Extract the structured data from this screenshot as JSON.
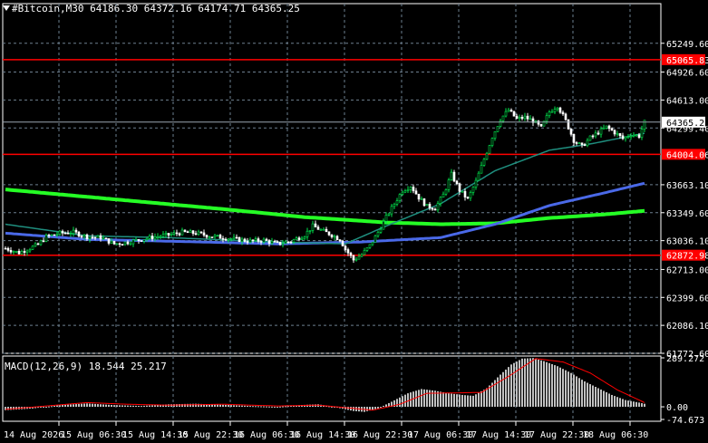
{
  "header": {
    "symbol": "#Bitcoin,M30",
    "ohlc": "64186.30 64372.16 64174.71 64365.25"
  },
  "macd_header": {
    "label": "MACD(12,26,9) 18.544 25.217"
  },
  "colors": {
    "background": "#000000",
    "grid": "#6d7f8f",
    "bull_candle": "#00e64d",
    "bear_candle": "#ffffff",
    "ma_fast": "#1f8f7f",
    "ma_mid": "#4a69e8",
    "ma_slow": "#25ff25",
    "level_line": "#ff0000",
    "macd_hist": "#c0c0c0",
    "macd_signal": "#ff0000",
    "text": "#ffffff"
  },
  "chart_data": [
    {
      "type": "candlestick",
      "title": "#Bitcoin,M30",
      "y_range": [
        61772.6,
        65562.06
      ],
      "price_ticks": [
        "65249.60",
        "64926.60",
        "64613.00",
        "64299.40",
        "63663.10",
        "63349.60",
        "63036.10",
        "62713.00",
        "62399.60",
        "62086.10",
        "61772.60"
      ],
      "time_labels": [
        "14 Aug 2026",
        "15 Aug 06:30",
        "15 Aug 14:30",
        "15 Aug 22:30",
        "16 Aug 06:30",
        "16 Aug 14:30",
        "16 Aug 22:30",
        "17 Aug 06:30",
        "17 Aug 14:30",
        "17 Aug 22:30",
        "18 Aug 06:30"
      ],
      "current_price": "64365.25",
      "levels": [
        {
          "label": "65065.83",
          "value": 65065.83
        },
        {
          "label": "64004.06",
          "value": 64004.06
        },
        {
          "label": "62872.98",
          "value": 62872.98
        }
      ],
      "close_path": [
        [
          0,
          62950
        ],
        [
          5,
          62900
        ],
        [
          8,
          62940
        ],
        [
          12,
          62990
        ],
        [
          15,
          63080
        ],
        [
          20,
          63120
        ],
        [
          25,
          63130
        ],
        [
          30,
          63080
        ],
        [
          35,
          63070
        ],
        [
          40,
          63000
        ],
        [
          45,
          63020
        ],
        [
          50,
          63050
        ],
        [
          55,
          63080
        ],
        [
          60,
          63100
        ],
        [
          65,
          63130
        ],
        [
          70,
          63120
        ],
        [
          75,
          63090
        ],
        [
          80,
          63070
        ],
        [
          85,
          63050
        ],
        [
          90,
          63030
        ],
        [
          95,
          63040
        ],
        [
          100,
          63000
        ],
        [
          105,
          63030
        ],
        [
          110,
          63100
        ],
        [
          113,
          63200
        ],
        [
          117,
          63140
        ],
        [
          120,
          63100
        ],
        [
          123,
          63050
        ],
        [
          125,
          62940
        ],
        [
          128,
          62820
        ],
        [
          131,
          62880
        ],
        [
          134,
          62980
        ],
        [
          137,
          63130
        ],
        [
          140,
          63300
        ],
        [
          143,
          63450
        ],
        [
          146,
          63600
        ],
        [
          149,
          63650
        ],
        [
          152,
          63520
        ],
        [
          155,
          63420
        ],
        [
          158,
          63400
        ],
        [
          161,
          63550
        ],
        [
          164,
          63780
        ],
        [
          167,
          63600
        ],
        [
          170,
          63500
        ],
        [
          173,
          63700
        ],
        [
          176,
          63950
        ],
        [
          179,
          64200
        ],
        [
          182,
          64400
        ],
        [
          185,
          64500
        ],
        [
          188,
          64400
        ],
        [
          191,
          64420
        ],
        [
          194,
          64380
        ],
        [
          197,
          64300
        ],
        [
          200,
          64480
        ],
        [
          203,
          64550
        ],
        [
          206,
          64380
        ],
        [
          209,
          64160
        ],
        [
          212,
          64090
        ],
        [
          215,
          64190
        ],
        [
          218,
          64250
        ],
        [
          221,
          64310
        ],
        [
          224,
          64250
        ],
        [
          227,
          64180
        ],
        [
          230,
          64230
        ],
        [
          233,
          64210
        ],
        [
          235,
          64365
        ]
      ],
      "ma_slow": [
        [
          0,
          63610
        ],
        [
          40,
          63500
        ],
        [
          80,
          63390
        ],
        [
          110,
          63300
        ],
        [
          140,
          63240
        ],
        [
          160,
          63220
        ],
        [
          180,
          63230
        ],
        [
          200,
          63290
        ],
        [
          220,
          63330
        ],
        [
          235,
          63370
        ]
      ],
      "ma_mid": [
        [
          0,
          63120
        ],
        [
          30,
          63050
        ],
        [
          60,
          63030
        ],
        [
          100,
          63000
        ],
        [
          130,
          63020
        ],
        [
          160,
          63070
        ],
        [
          180,
          63220
        ],
        [
          200,
          63430
        ],
        [
          220,
          63570
        ],
        [
          235,
          63680
        ]
      ],
      "ma_fast": [
        [
          0,
          63220
        ],
        [
          30,
          63090
        ],
        [
          60,
          63070
        ],
        [
          100,
          63020
        ],
        [
          125,
          63000
        ],
        [
          140,
          63200
        ],
        [
          160,
          63450
        ],
        [
          180,
          63820
        ],
        [
          200,
          64050
        ],
        [
          215,
          64120
        ],
        [
          235,
          64240
        ]
      ]
    },
    {
      "type": "bar",
      "title": "MACD(12,26,9) 18.544 25.217",
      "y_range": [
        -74.673,
        289.272
      ],
      "ticks": [
        "289.272",
        "0.00",
        "-74.673"
      ],
      "histogram_path": [
        [
          0,
          -20
        ],
        [
          10,
          -10
        ],
        [
          20,
          10
        ],
        [
          30,
          20
        ],
        [
          40,
          10
        ],
        [
          50,
          5
        ],
        [
          60,
          15
        ],
        [
          70,
          18
        ],
        [
          80,
          12
        ],
        [
          90,
          5
        ],
        [
          100,
          0
        ],
        [
          108,
          10
        ],
        [
          115,
          15
        ],
        [
          122,
          -5
        ],
        [
          128,
          -25
        ],
        [
          132,
          -30
        ],
        [
          137,
          -10
        ],
        [
          142,
          30
        ],
        [
          148,
          80
        ],
        [
          153,
          105
        ],
        [
          158,
          95
        ],
        [
          163,
          80
        ],
        [
          168,
          70
        ],
        [
          172,
          65
        ],
        [
          177,
          110
        ],
        [
          182,
          190
        ],
        [
          186,
          250
        ],
        [
          190,
          285
        ],
        [
          194,
          288
        ],
        [
          198,
          270
        ],
        [
          203,
          240
        ],
        [
          208,
          200
        ],
        [
          213,
          150
        ],
        [
          218,
          110
        ],
        [
          223,
          70
        ],
        [
          228,
          40
        ],
        [
          233,
          25
        ],
        [
          235,
          18
        ]
      ],
      "signal_path": [
        [
          0,
          -15
        ],
        [
          15,
          5
        ],
        [
          30,
          25
        ],
        [
          45,
          15
        ],
        [
          60,
          10
        ],
        [
          80,
          15
        ],
        [
          100,
          5
        ],
        [
          115,
          10
        ],
        [
          125,
          -5
        ],
        [
          135,
          -20
        ],
        [
          145,
          15
        ],
        [
          155,
          80
        ],
        [
          165,
          82
        ],
        [
          175,
          85
        ],
        [
          185,
          180
        ],
        [
          195,
          285
        ],
        [
          205,
          265
        ],
        [
          215,
          200
        ],
        [
          225,
          100
        ],
        [
          235,
          25
        ]
      ]
    }
  ]
}
